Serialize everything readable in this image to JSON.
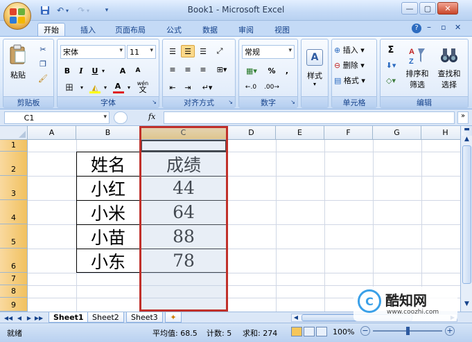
{
  "window": {
    "title": "Book1 - Microsoft Excel",
    "min_label": "—",
    "max_label": "▢",
    "close_label": "✕"
  },
  "quick_access": {
    "save_icon": "save-icon",
    "undo_icon": "undo-icon",
    "redo_icon": "redo-icon",
    "customize_icon": "dropdown-icon"
  },
  "tabs": [
    "开始",
    "插入",
    "页面布局",
    "公式",
    "数据",
    "审阅",
    "视图"
  ],
  "ribbon": {
    "clipboard": {
      "label": "剪贴板",
      "paste": "粘贴"
    },
    "font": {
      "label": "字体",
      "font_name": "宋体",
      "font_size": "11",
      "bold": "B",
      "italic": "I",
      "underline": "U",
      "grow": "A",
      "shrink": "A",
      "wen": "wén"
    },
    "alignment": {
      "label": "对齐方式"
    },
    "number": {
      "label": "数字",
      "format": "常规",
      "percent": "%",
      "comma": ","
    },
    "styles": {
      "label": "样式",
      "button": "样式"
    },
    "cells": {
      "label": "单元格",
      "insert": "插入",
      "delete": "删除",
      "format": "格式"
    },
    "editing": {
      "label": "编辑",
      "sigma": "Σ",
      "sort": "排序和",
      "filter": "筛选",
      "find": "查找和",
      "select": "选择"
    }
  },
  "formula_bar": {
    "name_box": "C1",
    "fx": "fx",
    "content": ""
  },
  "columns": [
    "A",
    "B",
    "C",
    "D",
    "E",
    "F",
    "G",
    "H"
  ],
  "rows": [
    "1",
    "2",
    "3",
    "4",
    "5",
    "6",
    "7",
    "8",
    "9"
  ],
  "table": {
    "header": {
      "name": "姓名",
      "score": "成绩"
    },
    "records": [
      {
        "name": "小红",
        "score": "44"
      },
      {
        "name": "小米",
        "score": "64"
      },
      {
        "name": "小苗",
        "score": "88"
      },
      {
        "name": "小东",
        "score": "78"
      }
    ]
  },
  "sheets": [
    "Sheet1",
    "Sheet2",
    "Sheet3"
  ],
  "status": {
    "mode": "就绪",
    "average": "平均值: 68.5",
    "count": "计数: 5",
    "sum": "求和: 274",
    "zoom": "100%"
  },
  "watermark": {
    "brand": "酷知网",
    "url": "www.coozhi.com"
  },
  "colors": {
    "selection_border": "#c0302a",
    "ribbon_bg": "#dce9fa",
    "selected_header": "#f1c15f"
  }
}
